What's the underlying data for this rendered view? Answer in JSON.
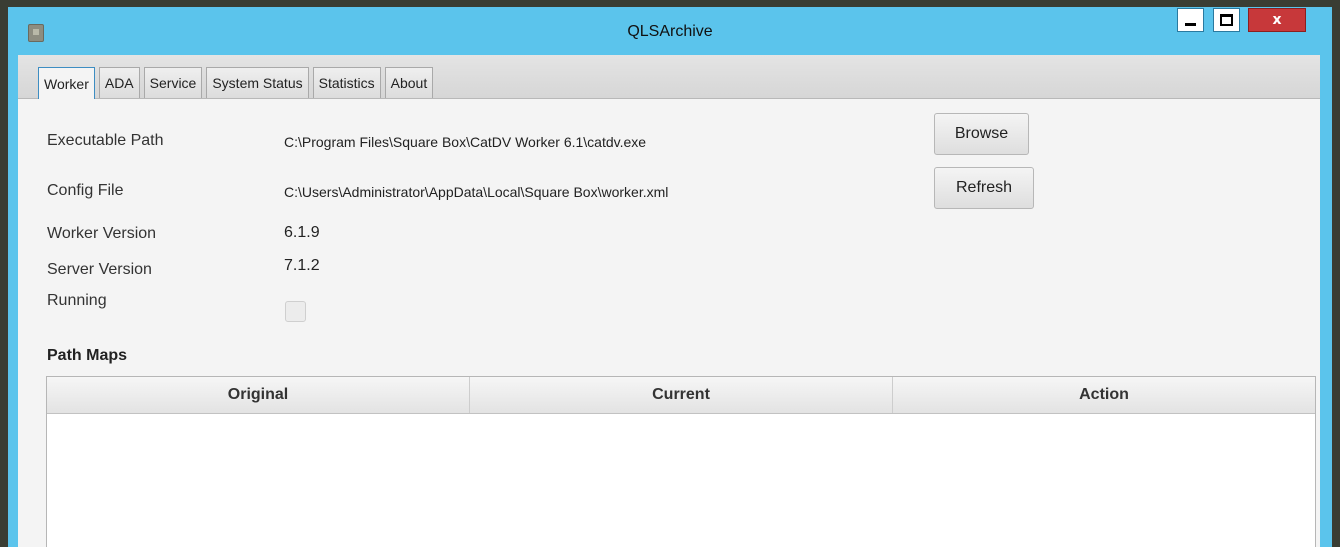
{
  "window": {
    "title": "QLSArchive",
    "controls": {
      "minimize": "minimize-icon",
      "maximize": "maximize-icon",
      "close": "x"
    }
  },
  "tabs": [
    {
      "label": "Worker",
      "active": true
    },
    {
      "label": "ADA",
      "active": false
    },
    {
      "label": "Service",
      "active": false
    },
    {
      "label": "System Status",
      "active": false
    },
    {
      "label": "Statistics",
      "active": false
    },
    {
      "label": "About",
      "active": false
    }
  ],
  "worker": {
    "executable_path_label": "Executable Path",
    "executable_path_value": "C:\\Program Files\\Square Box\\CatDV Worker 6.1\\catdv.exe",
    "browse_label": "Browse",
    "config_file_label": "Config File",
    "config_file_value": "C:\\Users\\Administrator\\AppData\\Local\\Square Box\\worker.xml",
    "refresh_label": "Refresh",
    "worker_version_label": "Worker Version",
    "worker_version_value": "6.1.9",
    "server_version_label": "Server Version",
    "server_version_value": "7.1.2",
    "running_label": "Running",
    "running_checked": false
  },
  "path_maps": {
    "title": "Path Maps",
    "columns": [
      "Original",
      "Current",
      "Action"
    ],
    "rows": []
  },
  "colors": {
    "titlebar": "#5bc4ec",
    "close_button": "#c7383a",
    "active_tab_border": "#3d8dc2"
  }
}
